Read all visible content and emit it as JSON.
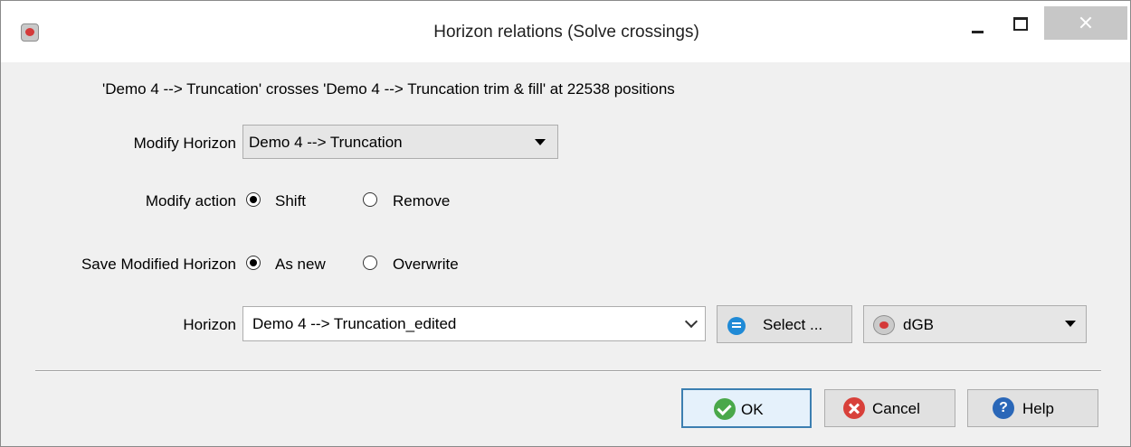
{
  "window": {
    "title": "Horizon relations (Solve crossings)"
  },
  "message": "'Demo 4 --> Truncation' crosses 'Demo 4 --> Truncation trim & fill' at 22538 positions",
  "modify_horizon": {
    "label": "Modify Horizon",
    "value": "Demo 4 --> Truncation"
  },
  "modify_action": {
    "label": "Modify action",
    "options": [
      {
        "label": "Shift",
        "selected": true
      },
      {
        "label": "Remove",
        "selected": false
      }
    ]
  },
  "save_modified": {
    "label": "Save Modified Horizon",
    "options": [
      {
        "label": "As new",
        "selected": true
      },
      {
        "label": "Overwrite",
        "selected": false
      }
    ]
  },
  "horizon": {
    "label": "Horizon",
    "value": "Demo 4 --> Truncation_edited",
    "select_label": "Select ...",
    "survey_value": "dGB"
  },
  "buttons": {
    "ok": "OK",
    "cancel": "Cancel",
    "help": "Help"
  },
  "icons": {
    "app": "app-logo-icon",
    "select": "database-icon",
    "survey": "dgb-logo-icon",
    "ok": "check-circle-icon",
    "cancel": "x-circle-icon",
    "help": "question-circle-icon"
  },
  "colors": {
    "ok_icon": "#4aa84a",
    "cancel_icon": "#d8403a",
    "help_icon": "#2a67b8",
    "default_button_border": "#3c7fb1"
  }
}
